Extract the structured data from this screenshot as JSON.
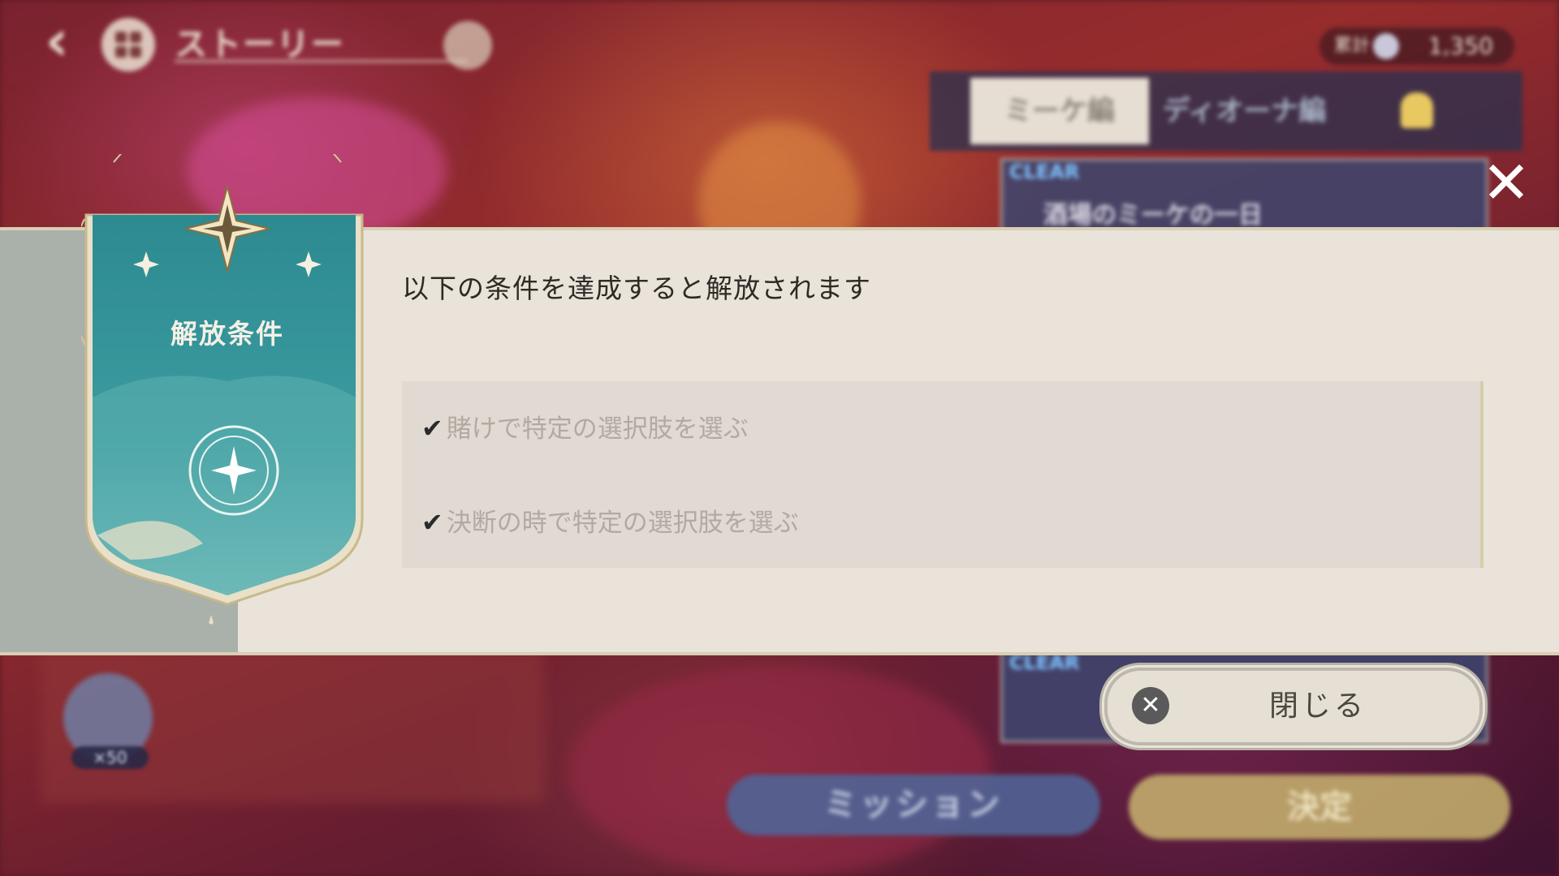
{
  "topbar": {
    "title": "ストーリー",
    "currency_label": "累計",
    "currency_value": "1,350"
  },
  "tabs": [
    {
      "label": "ミーケ編",
      "selected": true
    },
    {
      "label": "ディオーナ編",
      "selected": false
    },
    {
      "label": "",
      "locked": true,
      "icon": "lock-icon"
    }
  ],
  "cards": [
    {
      "tag": "CLEAR",
      "text": "酒場のミーケの一日"
    },
    {
      "tag": "CLEAR",
      "text": ""
    }
  ],
  "mission_badge": {
    "count": "×50"
  },
  "buttons": {
    "mission": "ミッション",
    "decide": "決定"
  },
  "modal": {
    "emblem_title": "解放条件",
    "heading": "以下の条件を達成すると解放されます",
    "conditions": [
      {
        "text": "賭けで特定の選択肢を選ぶ",
        "checked": true
      },
      {
        "text": "決断の時で特定の選択肢を選ぶ",
        "checked": true
      }
    ],
    "close_label": "閉じる"
  },
  "colors": {
    "panel": "#e9e3d9",
    "emblem_teal": "#2f8a90",
    "gold": "#d9cfb4",
    "background": "#7a2230"
  }
}
